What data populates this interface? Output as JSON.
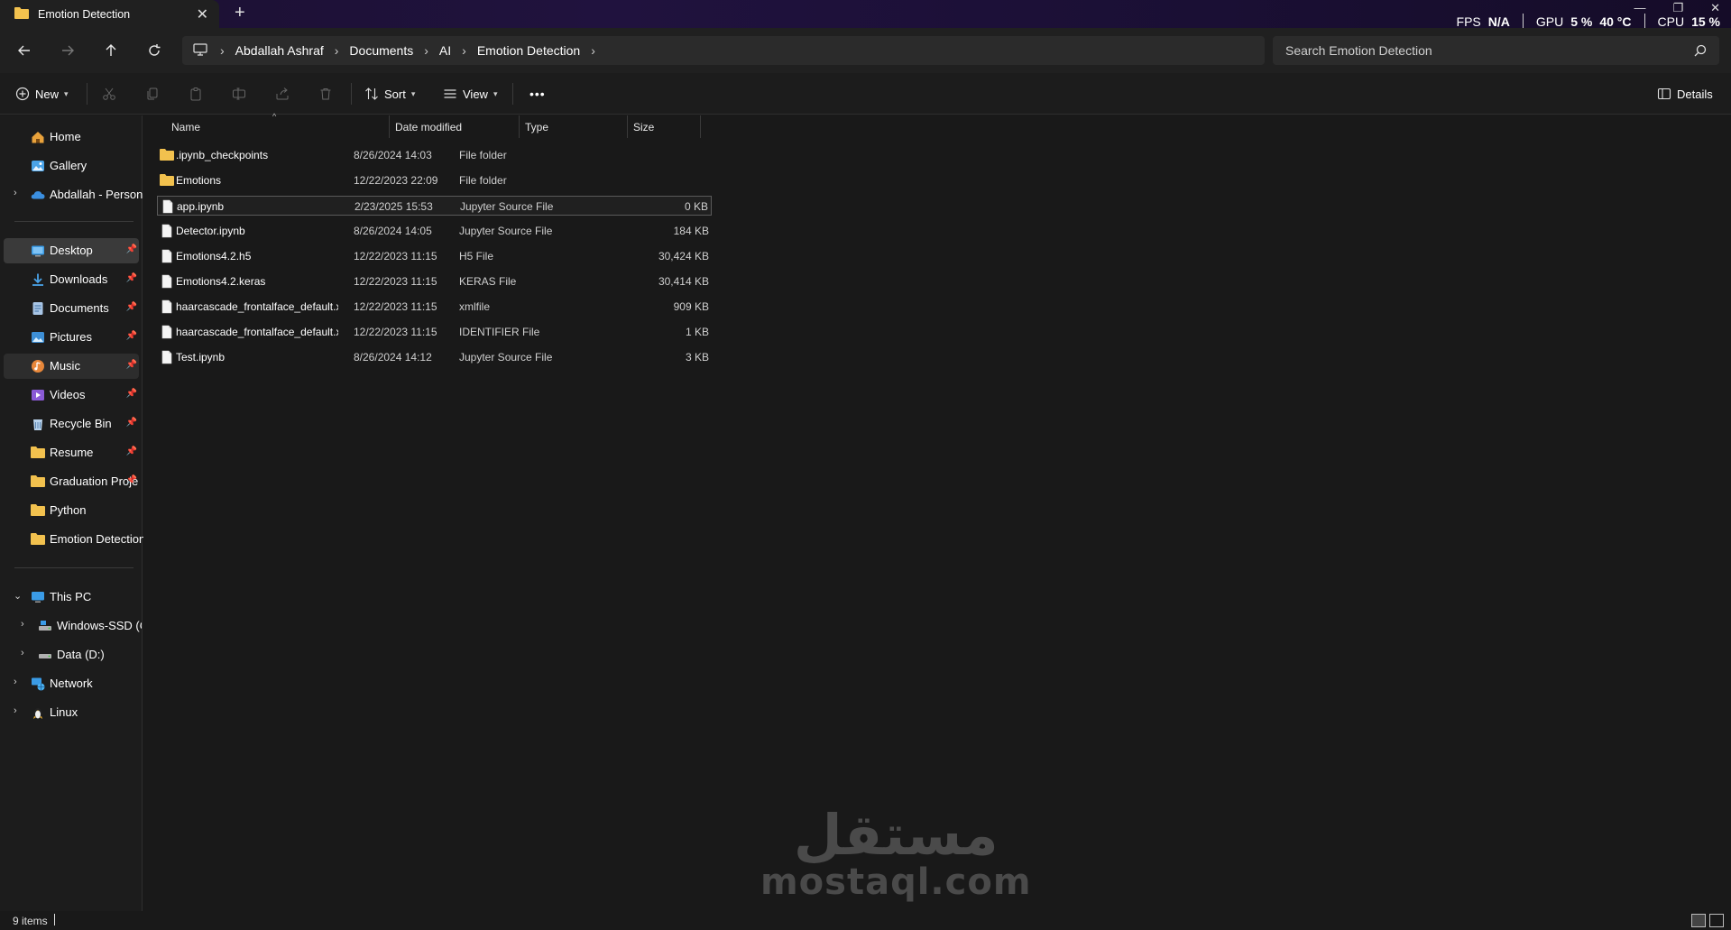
{
  "window": {
    "tab_title": "Emotion Detection",
    "tab_close": "✕",
    "new_tab": "+",
    "minimize": "—",
    "restore": "❐",
    "close": "✕"
  },
  "perf_overlay": {
    "fps_label": "FPS",
    "fps_value": "N/A",
    "gpu_label": "GPU",
    "gpu_value": "5 %",
    "gpu_temp": "40 °C",
    "cpu_label": "CPU",
    "cpu_value": "15 %"
  },
  "address_bar": {
    "breadcrumbs": [
      "Abdallah Ashraf",
      "Documents",
      "AI",
      "Emotion Detection"
    ]
  },
  "search": {
    "placeholder": "Search Emotion Detection"
  },
  "command_bar": {
    "new_label": "New",
    "sort_label": "Sort",
    "view_label": "View",
    "more_label": "•••",
    "details_label": "Details"
  },
  "sidebar": {
    "items": [
      {
        "label": "Home",
        "icon": "home-icon"
      },
      {
        "label": "Gallery",
        "icon": "gallery-icon"
      },
      {
        "label": "Abdallah - Persona",
        "icon": "onedrive-icon"
      },
      {
        "label": "Desktop",
        "icon": "desktop-icon"
      },
      {
        "label": "Downloads",
        "icon": "download-icon"
      },
      {
        "label": "Documents",
        "icon": "documents-icon"
      },
      {
        "label": "Pictures",
        "icon": "pictures-icon"
      },
      {
        "label": "Music",
        "icon": "music-icon"
      },
      {
        "label": "Videos",
        "icon": "videos-icon"
      },
      {
        "label": "Recycle Bin",
        "icon": "recycle-bin-icon"
      },
      {
        "label": "Resume",
        "icon": "folder-icon"
      },
      {
        "label": "Graduation Proje",
        "icon": "folder-icon"
      },
      {
        "label": "Python",
        "icon": "folder-icon"
      },
      {
        "label": "Emotion Detection",
        "icon": "folder-icon"
      },
      {
        "label": "This PC",
        "icon": "this-pc-icon"
      },
      {
        "label": "Windows-SSD (C:",
        "icon": "drive-c-icon"
      },
      {
        "label": "Data (D:)",
        "icon": "drive-d-icon"
      },
      {
        "label": "Network",
        "icon": "network-icon"
      },
      {
        "label": "Linux",
        "icon": "linux-icon"
      }
    ]
  },
  "file_list": {
    "columns": [
      "Name",
      "Date modified",
      "Type",
      "Size"
    ],
    "rows": [
      {
        "name": ".ipynb_checkpoints",
        "date": "8/26/2024 14:03",
        "type": "File folder",
        "size": "",
        "kind": "folder"
      },
      {
        "name": "Emotions",
        "date": "12/22/2023 22:09",
        "type": "File folder",
        "size": "",
        "kind": "folder"
      },
      {
        "name": "app.ipynb",
        "date": "2/23/2025 15:53",
        "type": "Jupyter Source File",
        "size": "0 KB",
        "kind": "file"
      },
      {
        "name": "Detector.ipynb",
        "date": "8/26/2024 14:05",
        "type": "Jupyter Source File",
        "size": "184 KB",
        "kind": "file"
      },
      {
        "name": "Emotions4.2.h5",
        "date": "12/22/2023 11:15",
        "type": "H5 File",
        "size": "30,424 KB",
        "kind": "file"
      },
      {
        "name": "Emotions4.2.keras",
        "date": "12/22/2023 11:15",
        "type": "KERAS File",
        "size": "30,414 KB",
        "kind": "file"
      },
      {
        "name": "haarcascade_frontalface_default.xml",
        "date": "12/22/2023 11:15",
        "type": "xmlfile",
        "size": "909 KB",
        "kind": "file"
      },
      {
        "name": "haarcascade_frontalface_default.xml:Zo...",
        "date": "12/22/2023 11:15",
        "type": "IDENTIFIER File",
        "size": "1 KB",
        "kind": "file"
      },
      {
        "name": "Test.ipynb",
        "date": "8/26/2024 14:12",
        "type": "Jupyter Source File",
        "size": "3 KB",
        "kind": "file"
      }
    ]
  },
  "status_bar": {
    "item_count": "9 items"
  },
  "watermark": {
    "arabic": "مستقل",
    "latin": "mostaql.com"
  },
  "colors": {
    "folder": "#f2c14e",
    "accent": "#5fa8e8"
  }
}
